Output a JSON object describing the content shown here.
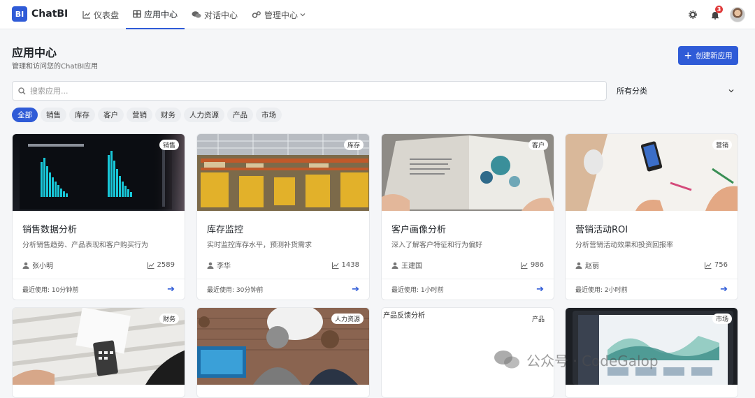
{
  "brand": {
    "logo_mark": "BI",
    "name": "ChatBI"
  },
  "nav": [
    {
      "label": "仪表盘",
      "icon": "chart-line-icon",
      "active": false
    },
    {
      "label": "应用中心",
      "icon": "grid-icon",
      "active": true
    },
    {
      "label": "对话中心",
      "icon": "chat-bubbles-icon",
      "active": false
    },
    {
      "label": "管理中心",
      "icon": "gears-icon",
      "active": false,
      "dropdown": true
    }
  ],
  "notifications": {
    "count": "3"
  },
  "header": {
    "title": "应用中心",
    "subtitle": "管理和访问您的ChatBI应用",
    "create_label": "创建新应用"
  },
  "search": {
    "placeholder": "搜索应用..."
  },
  "category_select": {
    "value": "所有分类"
  },
  "chips": [
    "全部",
    "销售",
    "库存",
    "客户",
    "营销",
    "财务",
    "人力资源",
    "产品",
    "市场"
  ],
  "active_chip": "全部",
  "cards": [
    {
      "title": "销售数据分析",
      "desc": "分析销售趋势、产品表现和客户购买行为",
      "tag": "销售",
      "owner": "张小明",
      "views": "2589",
      "last_used": "最近使用: 10分钟前"
    },
    {
      "title": "库存监控",
      "desc": "实时监控库存水平，预测补货需求",
      "tag": "库存",
      "owner": "李华",
      "views": "1438",
      "last_used": "最近使用: 30分钟前"
    },
    {
      "title": "客户画像分析",
      "desc": "深入了解客户特征和行为偏好",
      "tag": "客户",
      "owner": "王建国",
      "views": "986",
      "last_used": "最近使用: 1小时前"
    },
    {
      "title": "营销活动ROI",
      "desc": "分析营销活动效果和投资回报率",
      "tag": "营销",
      "owner": "赵丽",
      "views": "756",
      "last_used": "最近使用: 2小时前"
    },
    {
      "tag": "财务"
    },
    {
      "tag": "人力资源"
    },
    {
      "tag": "产品",
      "alt": "产品反馈分析"
    },
    {
      "tag": "市场"
    }
  ],
  "watermark": "公众号 · CodeGalop"
}
